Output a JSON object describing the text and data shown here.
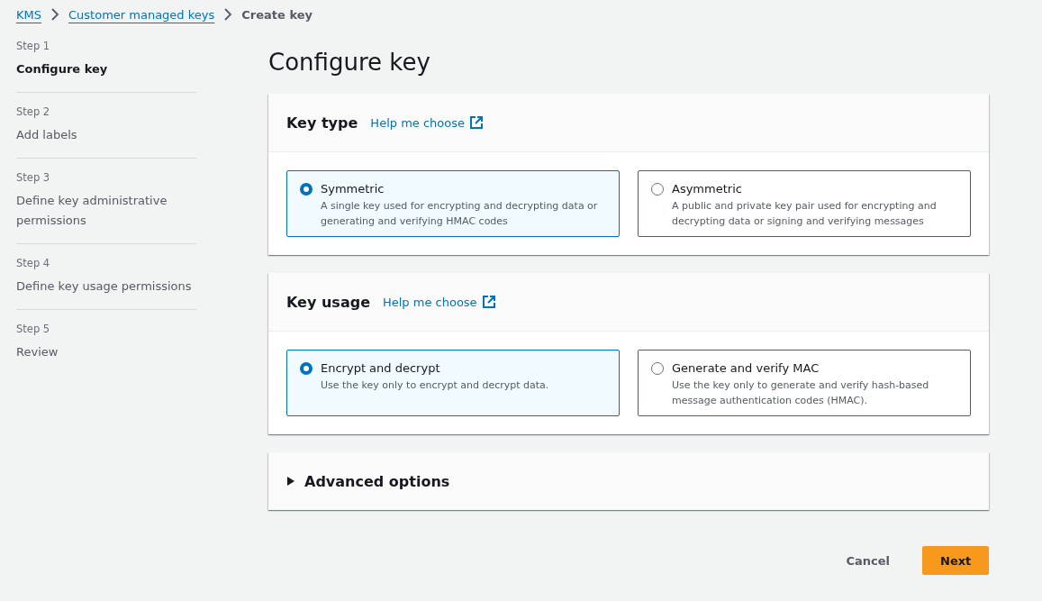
{
  "breadcrumb": [
    {
      "label": "KMS",
      "kind": "link"
    },
    {
      "label": "Customer managed keys",
      "kind": "link"
    },
    {
      "label": "Create key",
      "kind": "current"
    }
  ],
  "steps": [
    {
      "step": "Step 1",
      "label": "Configure key",
      "selected": true
    },
    {
      "step": "Step 2",
      "label": "Add labels",
      "selected": false
    },
    {
      "step": "Step 3",
      "label": "Define key administrative permissions",
      "selected": false
    },
    {
      "step": "Step 4",
      "label": "Define key usage permissions",
      "selected": false
    },
    {
      "step": "Step 5",
      "label": "Review",
      "selected": false
    }
  ],
  "title": "Configure key",
  "sections": [
    {
      "heading": "Key type",
      "help": "Help me choose",
      "options": [
        {
          "label": "Symmetric",
          "description": "A single key used for encrypting and decrypting data or generating and verifying HMAC codes",
          "selected": true
        },
        {
          "label": "Asymmetric",
          "description": "A public and private key pair used for encrypting and decrypting data or signing and verifying messages",
          "selected": false
        }
      ]
    },
    {
      "heading": "Key usage",
      "help": "Help me choose",
      "options": [
        {
          "label": "Encrypt and decrypt",
          "description": "Use the key only to encrypt and decrypt data.",
          "selected": true
        },
        {
          "label": "Generate and verify MAC",
          "description": "Use the key only to generate and verify hash-based message authentication codes (HMAC).",
          "selected": false
        }
      ]
    }
  ],
  "advanced": {
    "label": "Advanced options",
    "expanded": false
  },
  "buttons": [
    {
      "label": "Cancel",
      "kind": "link"
    },
    {
      "label": "Next",
      "kind": "primary"
    }
  ]
}
